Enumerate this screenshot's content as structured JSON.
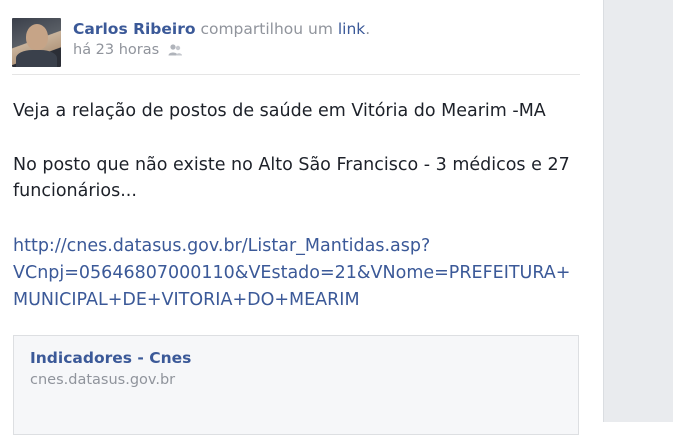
{
  "post": {
    "author": "Carlos Ribeiro",
    "action_text": " compartilhou um ",
    "action_link": "link",
    "action_end": ".",
    "timestamp": "há 23 horas",
    "privacy_icon": "friends-icon",
    "body_line1": "Veja a relação de postos de saúde em Vitória do Mearim -MA",
    "body_line2": "No posto que não existe no Alto São Francisco - 3 médicos e 27",
    "body_line3": "funcionários...",
    "url_line1": "http://cnes.datasus.gov.br/Listar_Mantidas.asp?",
    "url_line2": "VCnpj=05646807000110&VEstado=21&VNome=PREFEITURA+",
    "url_line3": "MUNICIPAL+DE+VITORIA+DO+MEARIM"
  },
  "attachment": {
    "title": "Indicadores - Cnes",
    "domain": "cnes.datasus.gov.br"
  },
  "colors": {
    "link": "#3b5998",
    "meta": "#90949c",
    "text": "#1d2129"
  }
}
